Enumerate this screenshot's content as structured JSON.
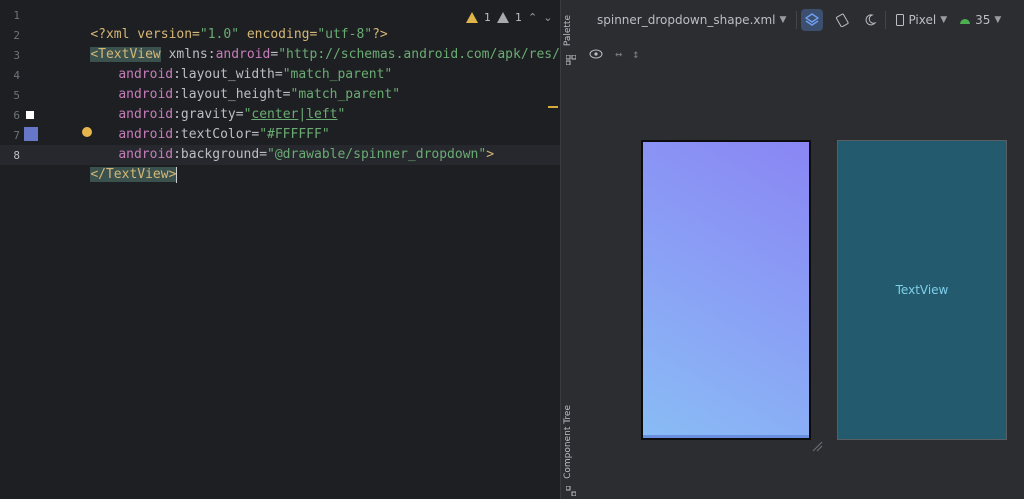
{
  "editor": {
    "line_numbers": [
      "1",
      "2",
      "3",
      "4",
      "5",
      "6",
      "7",
      "8"
    ],
    "lines": {
      "l1": {
        "decl": "<?xml version=",
        "v1": "\"1.0\"",
        "enc": " encoding=",
        "v2": "\"utf-8\"",
        "close": "?>"
      },
      "l2": {
        "open": "<TextView",
        "sp": " xmlns:",
        "ns": "android",
        "eq": "=",
        "val": "\"http://schemas.android.com/apk/res/android\""
      },
      "l3": {
        "ns": "android",
        "attr": ":layout_width=",
        "val": "\"match_parent\""
      },
      "l4": {
        "ns": "android",
        "attr": ":layout_height=",
        "val": "\"match_parent\""
      },
      "l5": {
        "ns": "android",
        "attr": ":gravity=",
        "q1": "\"",
        "v1": "center",
        "pipe": "|",
        "v2": "left",
        "q2": "\""
      },
      "l6": {
        "ns": "android",
        "attr": ":textColor=",
        "val": "\"#FFFFFF\""
      },
      "l7": {
        "ns": "android",
        "attr": ":background=",
        "val": "\"@drawable/spinner_dropdown\"",
        "close": ">"
      },
      "l8": {
        "close": "</TextView>"
      }
    },
    "warnings": {
      "yellow_count": "1",
      "grey_count": "1"
    },
    "swatches": {
      "text_color": "#FFFFFF",
      "background": "#6677c8"
    }
  },
  "side_panel": {
    "palette": "Palette",
    "component_tree": "Component Tree"
  },
  "toolbar": {
    "file_name": "spinner_dropdown_shape.xml",
    "device": "Pixel",
    "api_level": "35",
    "icons": [
      "design-surface-icon",
      "orientation-icon",
      "night-mode-icon",
      "device-icon",
      "android-icon"
    ]
  },
  "preview": {
    "text_view_label": "TextView"
  }
}
